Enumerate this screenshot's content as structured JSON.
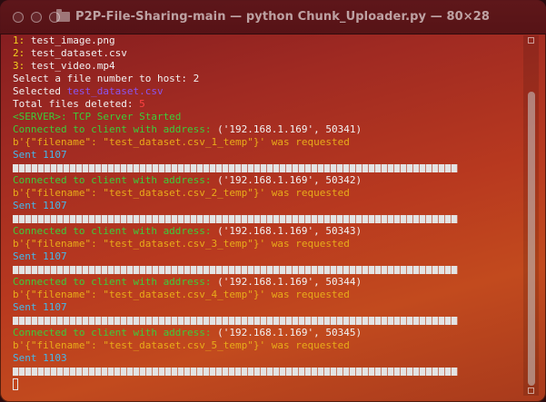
{
  "window": {
    "title": "P2P-File-Sharing-main — python Chunk_Uploader.py — 80×28"
  },
  "terminal": {
    "files": [
      {
        "num": "1:",
        "name": " test_image.png"
      },
      {
        "num": "2:",
        "name": " test_dataset.csv"
      },
      {
        "num": "3:",
        "name": " test_video.mp4"
      }
    ],
    "prompt": "Select a file number to host: 2",
    "selected_label": "Selected ",
    "selected_file": "test_dataset.csv",
    "deleted_label": "Total files deleted: ",
    "deleted_count": "5",
    "server_status": "<SERVER>: TCP Server Started",
    "connections": [
      {
        "connected": "Connected to client with address: ",
        "address": "('192.168.1.169', 50341)",
        "request": "b'{\"filename\": \"test_dataset.csv_1_temp\"}' was requested",
        "sent": "Sent 1107"
      },
      {
        "connected": "Connected to client with address: ",
        "address": "('192.168.1.169', 50342)",
        "request": "b'{\"filename\": \"test_dataset.csv_2_temp\"}' was requested",
        "sent": "Sent 1107"
      },
      {
        "connected": "Connected to client with address: ",
        "address": "('192.168.1.169', 50343)",
        "request": "b'{\"filename\": \"test_dataset.csv_3_temp\"}' was requested",
        "sent": "Sent 1107"
      },
      {
        "connected": "Connected to client with address: ",
        "address": "('192.168.1.169', 50344)",
        "request": "b'{\"filename\": \"test_dataset.csv_4_temp\"}' was requested",
        "sent": "Sent 1107"
      },
      {
        "connected": "Connected to client with address: ",
        "address": "('192.168.1.169', 50345)",
        "request": "b'{\"filename\": \"test_dataset.csv_5_temp\"}' was requested",
        "sent": "Sent 1103"
      }
    ]
  },
  "colors": {
    "file_number": "#f2d11f",
    "connected": "#3dcc3a",
    "requested": "#e8ab1a",
    "sent": "#45b8ea",
    "selected_file": "#8a55ef",
    "deleted_count": "#ff4242"
  }
}
